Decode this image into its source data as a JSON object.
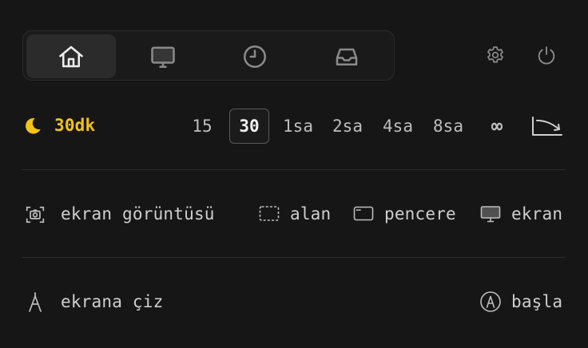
{
  "nav": {
    "tabs": [
      {
        "name": "home",
        "icon": "home-icon",
        "active": true
      },
      {
        "name": "display",
        "icon": "monitor-icon",
        "active": false
      },
      {
        "name": "history",
        "icon": "clock-icon",
        "active": false
      },
      {
        "name": "inbox",
        "icon": "inbox-tray-icon",
        "active": false
      }
    ],
    "settings_icon": "gear-icon",
    "power_icon": "power-icon"
  },
  "timer": {
    "icon": "moon-icon",
    "current": "30dk",
    "options": [
      "15",
      "30",
      "1sa",
      "2sa",
      "4sa",
      "8sa",
      "∞"
    ],
    "selected": "30",
    "end_icon": "trend-down-arrow-icon",
    "accent_color": "#f2c21b"
  },
  "screenshot": {
    "icon": "camera-icon",
    "label": "ekran görüntüsü",
    "area_label": "alan",
    "window_label": "pencere",
    "screen_label": "ekran"
  },
  "draw": {
    "icon": "compass-pen-icon",
    "label": "ekrana çiz",
    "start_label": "başla",
    "start_icon": "pen-circle-icon"
  }
}
